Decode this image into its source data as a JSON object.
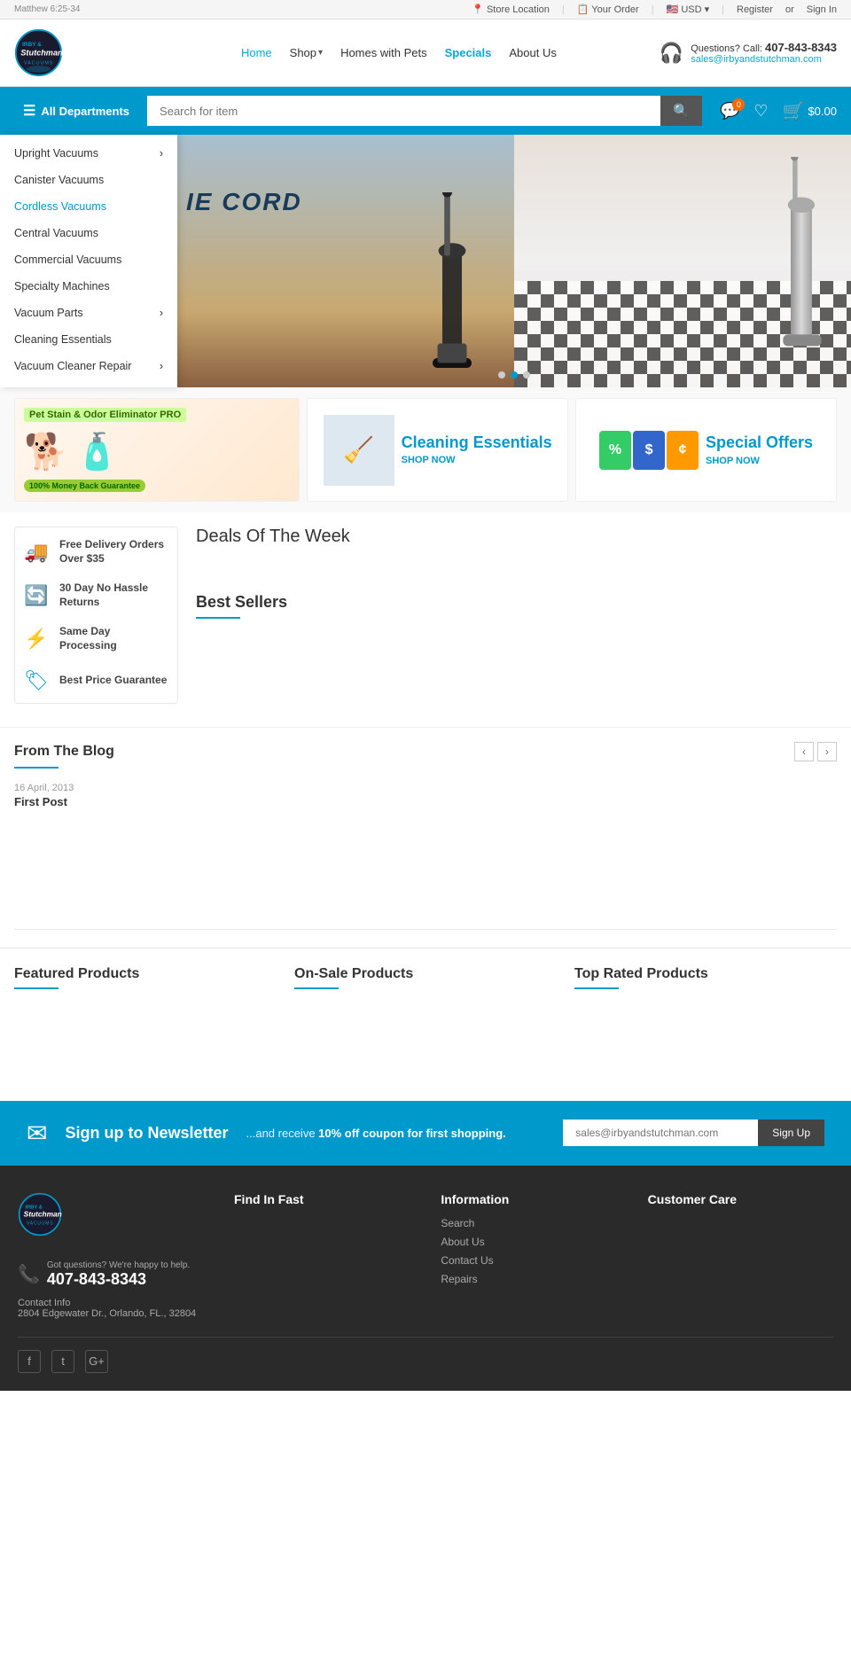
{
  "topbar": {
    "scripture": "Matthew 6:25-34",
    "store_location": "Store Location",
    "your_order": "Your Order",
    "currency": "USD",
    "register": "Register",
    "or": "or",
    "sign_in": "Sign In"
  },
  "header": {
    "logo_text": "Irby & Stutchman Vacuums",
    "nav": {
      "home": "Home",
      "shop": "Shop",
      "homes_with_pets": "Homes with Pets",
      "specials": "Specials",
      "about_us": "About Us"
    },
    "contact": {
      "label": "Questions? Call:",
      "phone": "407-843-8343",
      "email": "sales@irbyandstutchman.com"
    }
  },
  "searchbar": {
    "all_departments": "All Departments",
    "search_placeholder": "Search for item",
    "cart_amount": "$0.00",
    "cart_count": "0"
  },
  "dropdown": {
    "items": [
      {
        "label": "Upright Vacuums",
        "has_arrow": true
      },
      {
        "label": "Canister Vacuums",
        "has_arrow": false
      },
      {
        "label": "Cordless Vacuums",
        "has_arrow": false
      },
      {
        "label": "Central Vacuums",
        "has_arrow": false
      },
      {
        "label": "Commercial Vacuums",
        "has_arrow": false
      },
      {
        "label": "Specialty Machines",
        "has_arrow": false
      },
      {
        "label": "Vacuum Parts",
        "has_arrow": true
      },
      {
        "label": "Cleaning Essentials",
        "has_arrow": false
      },
      {
        "label": "Vacuum Cleaner Repair",
        "has_arrow": true
      }
    ]
  },
  "hero": {
    "title": "CUT THE CORD",
    "dots": 3,
    "active_dot": 1
  },
  "promo_banners": {
    "pet": {
      "label": "Pet Stain & Odor Eliminator PRO",
      "money_back": "100% Money Back Guarantee"
    },
    "cleaning": {
      "title": "Cleaning Essentials",
      "shop_now": "SHOP NOW"
    },
    "special": {
      "title": "Special Offers",
      "shop_now": "SHOP NOW"
    }
  },
  "benefits": [
    {
      "icon": "🚚",
      "text": "Free Delivery Orders Over $35"
    },
    {
      "icon": "🔄",
      "text": "30 Day No Hassle Returns"
    },
    {
      "icon": "⚡",
      "text": "Same Day Processing"
    },
    {
      "icon": "🏷",
      "text": "Best Price Guarantee"
    }
  ],
  "deals": {
    "title": "Deals Of The Week"
  },
  "best_sellers": {
    "title": "Best Sellers"
  },
  "blog": {
    "title": "From The Blog",
    "posts": [
      {
        "date": "16 April, 2013",
        "title": "First Post"
      }
    ]
  },
  "featured_sections": {
    "featured": "Featured Products",
    "on_sale": "On-Sale Products",
    "top_rated": "Top Rated Products"
  },
  "newsletter": {
    "title": "Sign up to Newsletter",
    "subtitle": "...and receive ",
    "highlight": "10% off coupon for first shopping.",
    "input_placeholder": "sales@irbyandstutchman.com",
    "button_label": "Sign Up"
  },
  "footer": {
    "phone_label": "Got questions? We're happy to help.",
    "phone": "407-843-8343",
    "contact_info_label": "Contact Info",
    "address": "2804 Edgewater Dr., Orlando, FL., 32804",
    "find_in_fast": {
      "title": "Find In Fast",
      "links": []
    },
    "information": {
      "title": "Information",
      "links": [
        "Search",
        "About Us",
        "Contact Us",
        "Repairs"
      ]
    },
    "customer_care": {
      "title": "Customer Care",
      "links": []
    },
    "social": [
      "f",
      "t",
      "G+"
    ]
  }
}
